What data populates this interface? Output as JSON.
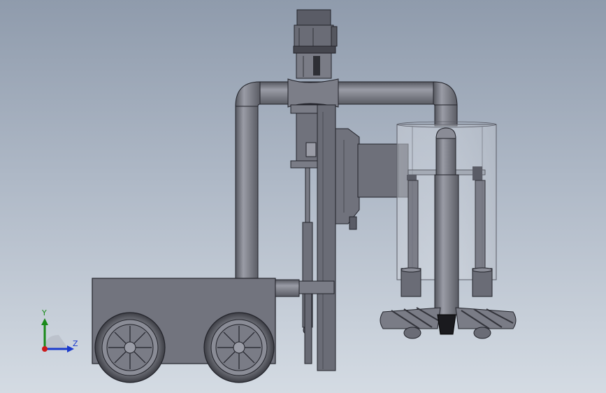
{
  "viewport": {
    "background_top": "#8f9bac",
    "background_bottom": "#d4dbe3"
  },
  "model": {
    "body_color": "#6f727c",
    "body_dark": "#4a4c54",
    "body_light": "#9a9ca6",
    "outline": "#22232a",
    "glass_color": "#c8cdd6"
  },
  "triad": {
    "y_label": "Y",
    "z_label": "Z",
    "y_color": "#1a8a1a",
    "z_color": "#1a3acc",
    "x_color": "#cc1a1a"
  }
}
